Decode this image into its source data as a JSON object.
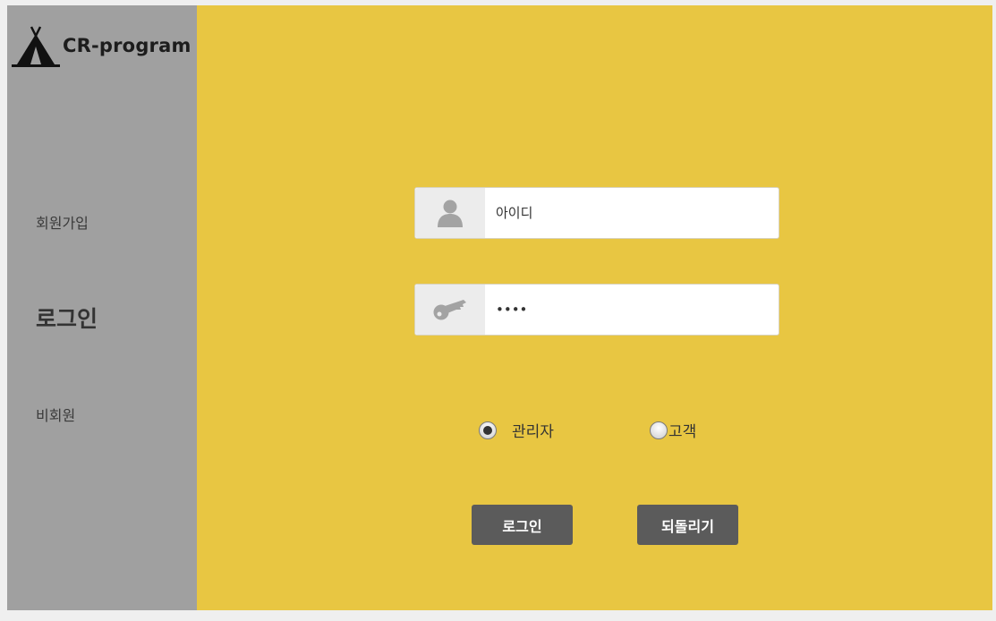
{
  "sidebar": {
    "logo_text": "CR-program",
    "logo_icon": "tent-icon",
    "items": [
      {
        "label": "회원가입"
      },
      {
        "label": "로그인",
        "active": true
      },
      {
        "label": "비회원"
      }
    ]
  },
  "login_form": {
    "id_field": {
      "placeholder": "아이디",
      "value": "",
      "icon": "user-icon"
    },
    "password_field": {
      "value": "••••",
      "icon": "key-icon"
    },
    "roles": [
      {
        "label": "관리자",
        "selected": true
      },
      {
        "label": "고객",
        "selected": false
      }
    ],
    "login_button": "로그인",
    "back_button": "되돌리기"
  },
  "colors": {
    "sidebar_bg": "#a0a0a0",
    "main_bg": "#e8c642",
    "button_bg": "#5b5b5b"
  }
}
